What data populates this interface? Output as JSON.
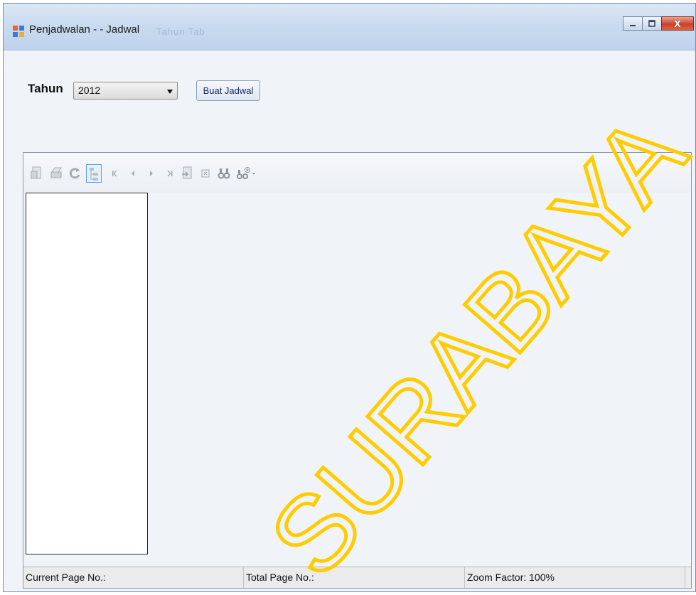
{
  "window": {
    "title": "Penjadwalan - - Jadwal",
    "ghost_text": "Tahun  Tab",
    "close_label": "X"
  },
  "form": {
    "tahun_label": "Tahun",
    "tahun_value": "2012",
    "buat_jadwal_label": "Buat Jadwal"
  },
  "toolbar": {
    "icons": [
      "export-icon",
      "print-icon",
      "refresh-icon",
      "group-tree-toggle-icon",
      "first-page-icon",
      "previous-page-icon",
      "next-page-icon",
      "last-page-icon",
      "goto-page-icon",
      "stop-icon",
      "find-icon",
      "zoom-icon"
    ]
  },
  "status": {
    "current_page": "Current Page No.:",
    "total_page": "Total Page No.:",
    "zoom_factor": "Zoom Factor: 100%"
  },
  "watermark": {
    "text": "SURABAYA",
    "color": "#ffcc00"
  },
  "colors": {
    "title_gradient_top": "#dbe7f5",
    "close_red": "#c8442b",
    "selection_blue": "#5b9be6"
  }
}
